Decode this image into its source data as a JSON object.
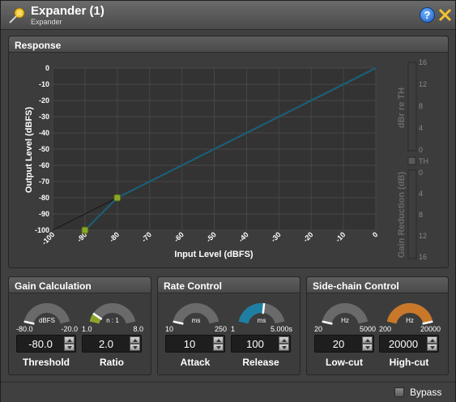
{
  "window": {
    "title": "Expander (1)",
    "subtitle": "Expander",
    "help_label": "?",
    "icons": {
      "app": "pushpin-icon",
      "help": "help-icon",
      "close": "close-icon"
    }
  },
  "response": {
    "title": "Response",
    "xlabel": "Input Level (dBFS)",
    "ylabel": "Output Level (dBFS)",
    "meter_top_label": "dBr re TH",
    "meter_bottom_label": "Gain Reduction (dB)",
    "th_label": "TH",
    "meter_top_ticks": [
      "16",
      "12",
      "8",
      "4",
      "0"
    ],
    "meter_bottom_ticks": [
      "0",
      "4",
      "8",
      "12",
      "16"
    ]
  },
  "chart_data": {
    "type": "line",
    "title": "",
    "xlabel": "Input Level (dBFS)",
    "ylabel": "Output Level (dBFS)",
    "xlim": [
      -100,
      0
    ],
    "ylim": [
      -100,
      0
    ],
    "grid": true,
    "x_ticks": [
      "-100",
      "-90",
      "-80",
      "-70",
      "-60",
      "-50",
      "-40",
      "-30",
      "-20",
      "-10",
      "0"
    ],
    "y_ticks": [
      "0",
      "-10",
      "-20",
      "-30",
      "-40",
      "-50",
      "-60",
      "-70",
      "-80",
      "-90",
      "-100"
    ],
    "series": [
      {
        "x": [
          -100,
          -80
        ],
        "y": [
          -100,
          -80
        ],
        "color": "#1a1a1a"
      },
      {
        "x": [
          -90,
          -80,
          0
        ],
        "y": [
          -100,
          -80,
          0
        ],
        "color": "#1b5e78"
      }
    ],
    "handles": [
      {
        "x": -80,
        "y": -80,
        "color": "#8aa62a"
      },
      {
        "x": -90,
        "y": -100,
        "color": "#8aa62a"
      }
    ]
  },
  "gain_calc": {
    "title": "Gain Calculation",
    "threshold": {
      "unit": "dBFS",
      "min": "-80.0",
      "max": "-20.0",
      "value": "-80.0",
      "label": "Threshold",
      "level": 0.0
    },
    "ratio": {
      "unit": "n : 1",
      "min": "1.0",
      "max": "8.0",
      "value": "2.0",
      "label": "Ratio",
      "level": 0.14
    }
  },
  "rate_control": {
    "title": "Rate Control",
    "attack": {
      "unit": "ms",
      "min": "10",
      "max": "250",
      "value": "10",
      "label": "Attack",
      "level": 0.0
    },
    "release": {
      "unit": "ms",
      "min": "1",
      "max": "5.000s",
      "value": "100",
      "label": "Release",
      "level": 0.54
    }
  },
  "sidechain": {
    "title": "Side-chain Control",
    "lowcut": {
      "unit": "Hz",
      "min": "20",
      "max": "5000",
      "value": "20",
      "label": "Low-cut",
      "level": 0.0
    },
    "highcut": {
      "unit": "Hz",
      "min": "200",
      "max": "20000",
      "value": "20000",
      "label": "High-cut",
      "level": 1.0
    }
  },
  "footer": {
    "bypass_label": "Bypass"
  },
  "colors": {
    "knob_track": "#6a6a6a",
    "release_fill": "#1f7fa3",
    "highcut_fill": "#c9782a",
    "ratio_fill": "#8aa62a"
  }
}
